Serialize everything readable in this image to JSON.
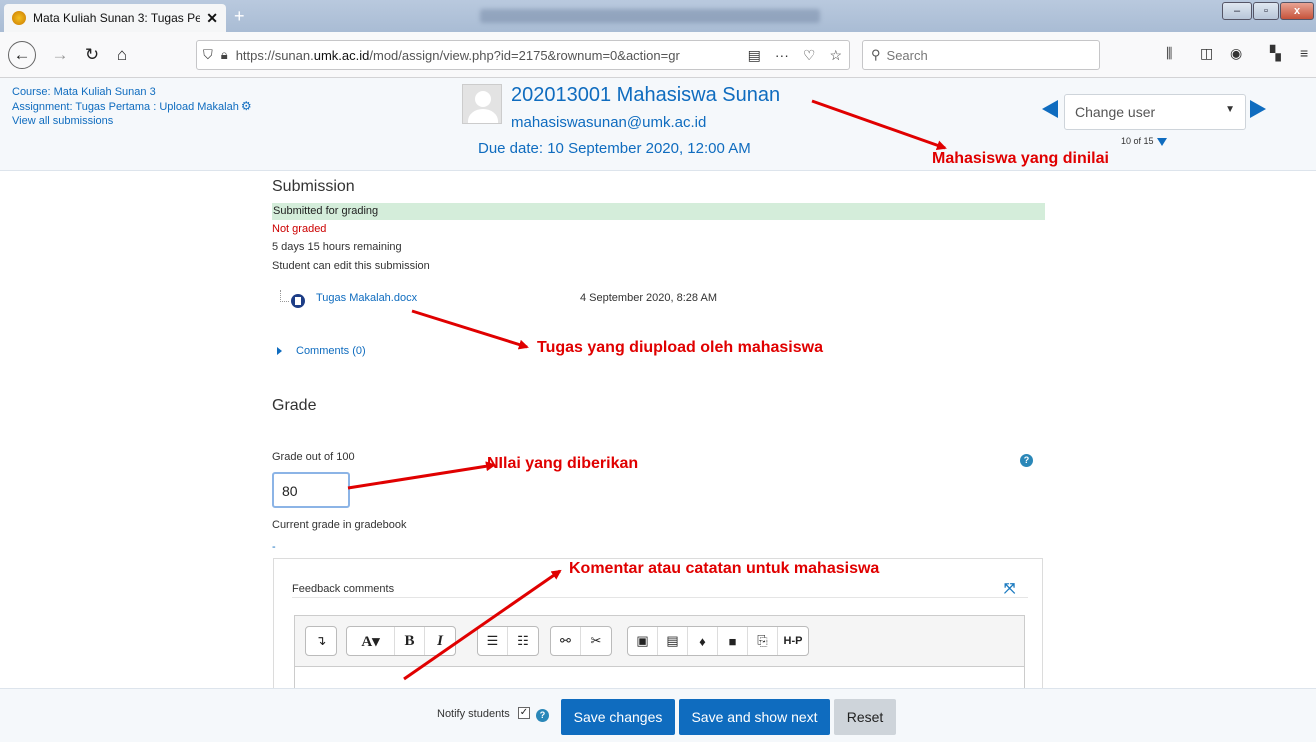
{
  "browser": {
    "tab_title": "Mata Kuliah Sunan 3: Tugas Pe",
    "tab_close": "✕",
    "new_tab": "+",
    "url_prefix": "https://sunan.",
    "url_host": "umk.ac.id",
    "url_path": "/mod/assign/view.php?id=2175&rownum=0&action=gr",
    "search_placeholder": "Search",
    "icons": [
      "back-icon",
      "forward-icon",
      "reload-icon",
      "home-icon",
      "shield-icon",
      "lock-icon",
      "reader-icon",
      "more-icon",
      "pocket-icon",
      "star-icon",
      "search-icon",
      "library-icon",
      "sidebar-icon",
      "account-icon",
      "extensions-icon",
      "menu-icon"
    ]
  },
  "header": {
    "course": "Course: Mata Kuliah Sunan 3",
    "assignment": "Assignment: Tugas Pertama : Upload Makalah",
    "view_all": "View all submissions",
    "user_name": "202013001 Mahasiswa Sunan",
    "user_email": "mahasiswasunan@umk.ac.id",
    "due_date": "Due date: 10 September 2020, 12:00 AM",
    "change_user": "Change user",
    "counter": "10 of 15"
  },
  "submission": {
    "heading": "Submission",
    "status": "Submitted for grading",
    "grading_status": "Not graded",
    "remaining": "5 days 15 hours remaining",
    "editable": "Student can edit this submission",
    "file_name": "Tugas Makalah.docx",
    "file_date": "4 September 2020, 8:28 AM",
    "comments": "Comments (0)"
  },
  "grade": {
    "heading": "Grade",
    "label": "Grade out of 100",
    "value": "80",
    "current_label": "Current grade in gradebook",
    "current_value": "-",
    "feedback_label": "Feedback comments"
  },
  "toolbar": {
    "buttons": [
      "↴",
      "A▾",
      "B",
      "I",
      "☰",
      "☷",
      "⚯",
      "✂",
      "▣",
      "▤",
      "♦",
      "■",
      "⎘",
      "H-P"
    ]
  },
  "footer": {
    "notify_label": "Notify students",
    "save": "Save changes",
    "save_next": "Save and show next",
    "reset": "Reset"
  },
  "annotations": {
    "student": "Mahasiswa yang dinilai",
    "upload": "Tugas yang diupload oleh mahasiswa",
    "grade": "NIlai yang diberikan",
    "comment": "Komentar atau catatan untuk mahasiswa"
  },
  "colors": {
    "moodle_blue": "#0f6cbf",
    "submitted_green": "#d4edda",
    "not_graded_red": "#cc0000",
    "annotation_red": "#e00000"
  }
}
